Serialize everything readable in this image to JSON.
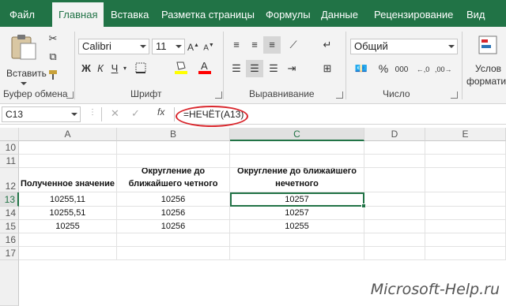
{
  "ribbon_tabs": [
    "Файл",
    "Главная",
    "Вставка",
    "Разметка страницы",
    "Формулы",
    "Данные",
    "Рецензирование",
    "Вид"
  ],
  "ribbon": {
    "paste_label": "Вставить",
    "clipboard_label": "Буфер обмена",
    "font_name": "Calibri",
    "font_size": "11",
    "bold": "Ж",
    "italic": "К",
    "underline": "Ч",
    "font_label": "Шрифт",
    "alignment_label": "Выравнивание",
    "number_format": "Общий",
    "number_label": "Число",
    "conditional_formatting_line1": "Услов",
    "conditional_formatting_line2": "форматиро",
    "percent": "%",
    "thousands": "000",
    "accent_color": "#217346",
    "highlight_color": "#ffff00",
    "font_color": "#ff0000",
    "icons": [
      "cut-icon",
      "copy-icon",
      "format-painter-icon",
      "borders-icon",
      "fill-color-icon",
      "font-color-icon",
      "align-top-icon",
      "align-middle-icon",
      "align-bottom-icon",
      "align-left-icon",
      "align-center-icon",
      "align-right-icon",
      "wrap-text-icon",
      "merge-icon",
      "currency-icon",
      "increase-decimal-icon",
      "decrease-decimal-icon"
    ]
  },
  "formula_bar": {
    "name_box": "C13",
    "fx": "fx",
    "formula": "=НЕЧЁТ(A13)",
    "annotation_color": "#d9262c"
  },
  "sheet": {
    "columns": [
      "A",
      "B",
      "C",
      "D",
      "E"
    ],
    "selected_column": "C",
    "rows": [
      "10",
      "11",
      "12",
      "13",
      "14",
      "15",
      "16",
      "17"
    ],
    "selected_row": "13",
    "headers": {
      "a": "Полученное значение",
      "b": "Округление до ближайшего четного",
      "c": "Округление до ближайшего нечетного"
    },
    "data": [
      [
        "10255,11",
        "10256",
        "10257"
      ],
      [
        "10255,51",
        "10256",
        "10257"
      ],
      [
        "10255",
        "10256",
        "10255"
      ]
    ],
    "active_cell": "C13"
  },
  "watermark": "Microsoft-Help.ru"
}
